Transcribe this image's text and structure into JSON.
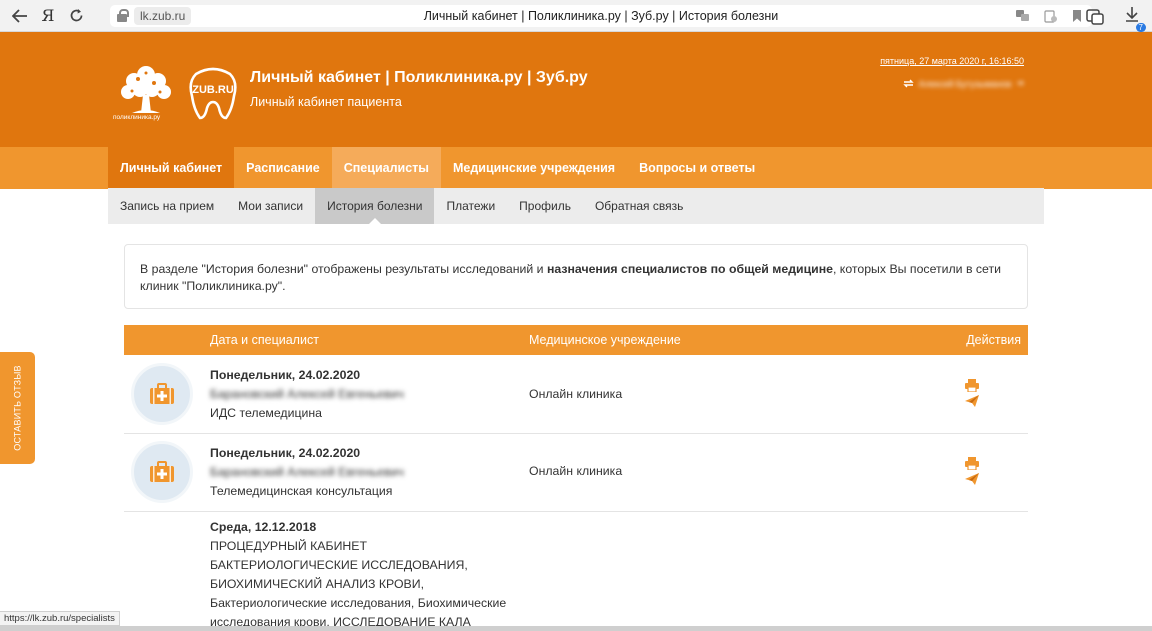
{
  "browser": {
    "domain": "lk.zub.ru",
    "tab_title": "Личный кабинет | Поликлиника.ру | Зуб.ру | История болезни",
    "yandex_glyph": "Я",
    "download_count": "7"
  },
  "header": {
    "logo_tree_label": "поликлиника.ру",
    "logo_zub_text": "ZUB.RU",
    "title": "Личный кабинет | Поликлиника.ру | Зуб.ру",
    "subtitle": "Личный кабинет пациента",
    "datetime": "пятница, 27 марта 2020 г, 16:16:50",
    "username": "Алексей Бутузыманов"
  },
  "main_nav": [
    {
      "label": "Личный кабинет"
    },
    {
      "label": "Расписание"
    },
    {
      "label": "Специалисты"
    },
    {
      "label": "Медицинские учреждения"
    },
    {
      "label": "Вопросы и ответы"
    }
  ],
  "sub_nav": [
    {
      "label": "Запись на прием"
    },
    {
      "label": "Мои записи"
    },
    {
      "label": "История болезни"
    },
    {
      "label": "Платежи"
    },
    {
      "label": "Профиль"
    },
    {
      "label": "Обратная связь"
    }
  ],
  "info": {
    "text_before": "В разделе \"История болезни\" отображены результаты исследований и ",
    "bold": "назначения специалистов по общей медицине",
    "text_after": ", которых Вы посетили в сети клиник \"Поликлиника.ру\"."
  },
  "table": {
    "headers": {
      "date_specialist": "Дата и специалист",
      "institution": "Медицинское учреждение",
      "actions": "Действия"
    },
    "rows": [
      {
        "date": "Понедельник, 24.02.2020",
        "doctor": "Барановский Алексей Евгеньевич",
        "service": "ИДС телемедицина",
        "institution": "Онлайн клиника"
      },
      {
        "date": "Понедельник, 24.02.2020",
        "doctor": "Барановский Алексей Евгеньевич",
        "service": "Телемедицинская консультация",
        "institution": "Онлайн клиника"
      },
      {
        "date": "Среда, 12.12.2018",
        "lines": [
          "ПРОЦЕДУРНЫЙ КАБИНЕТ",
          "БАКТЕРИОЛОГИЧЕСКИЕ ИССЛЕДОВАНИЯ,",
          "БИОХИМИЧЕСКИЙ АНАЛИЗ КРОВИ,",
          "Бактериологические исследования, Биохимические",
          "исследования крови, ИССЛЕДОВАНИЕ КАЛА"
        ]
      }
    ]
  },
  "feedback_label": "ОСТАВИТЬ ОТЗЫВ",
  "status_url": "https://lk.zub.ru/specialists",
  "icons": {
    "medical": "briefcase-medical-icon",
    "print": "printer-icon",
    "send": "paper-plane-icon"
  },
  "colors": {
    "header_orange": "#e0760e",
    "nav_orange": "#f0962e"
  }
}
